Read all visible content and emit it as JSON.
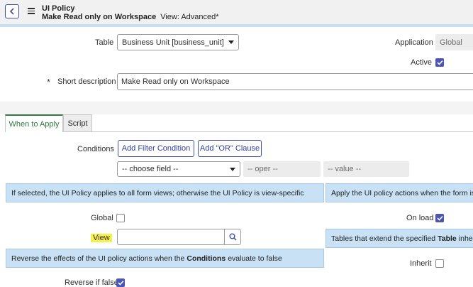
{
  "header": {
    "title": "UI Policy",
    "record_name": "Make Read only on Workspace",
    "view_label": "View: Advanced*"
  },
  "form": {
    "table": {
      "label": "Table",
      "value": "Business Unit [business_unit]"
    },
    "application": {
      "label": "Application",
      "value": "Global"
    },
    "active": {
      "label": "Active",
      "checked": true
    },
    "short_description": {
      "label": "Short description",
      "value": "Make Read only on Workspace",
      "required_marker": "*"
    }
  },
  "tabs": [
    {
      "label": "When to Apply",
      "active": true
    },
    {
      "label": "Script",
      "active": false
    }
  ],
  "conditions": {
    "label": "Conditions",
    "add_filter_button": "Add Filter Condition",
    "add_or_button": "Add \"OR\" Clause",
    "field_placeholder": "-- choose field --",
    "oper_placeholder": "-- oper --",
    "value_placeholder": "-- value --"
  },
  "info": {
    "global_hint": "If selected, the UI Policy applies to all form views; otherwise the UI Policy is view-specific",
    "onload_hint": "Apply the UI policy actions when the form is lo",
    "inherit_hint_pre": "Tables that extend the specified",
    "inherit_hint_bold": "Table",
    "inherit_hint_post": "inherit t",
    "reverse_hint_pre": "Reverse the effects of the UI policy actions when the",
    "reverse_hint_bold": "Conditions",
    "reverse_hint_post": "evaluate to false"
  },
  "options": {
    "global": {
      "label": "Global",
      "checked": false
    },
    "on_load": {
      "label": "On load",
      "checked": true
    },
    "view": {
      "label": "View",
      "value": ""
    },
    "inherit": {
      "label": "Inherit",
      "checked": false
    },
    "reverse_if_false": {
      "label": "Reverse if false",
      "checked": true
    }
  },
  "colors": {
    "accent": "#4a55b5",
    "tab_active": "#2e7a3f",
    "info_background": "#c9e1f4",
    "highlight": "#f7f04a"
  },
  "icons": [
    "back-icon",
    "hamburger-menu-icon",
    "search-icon",
    "checkmark-icon",
    "caret-down-icon"
  ]
}
